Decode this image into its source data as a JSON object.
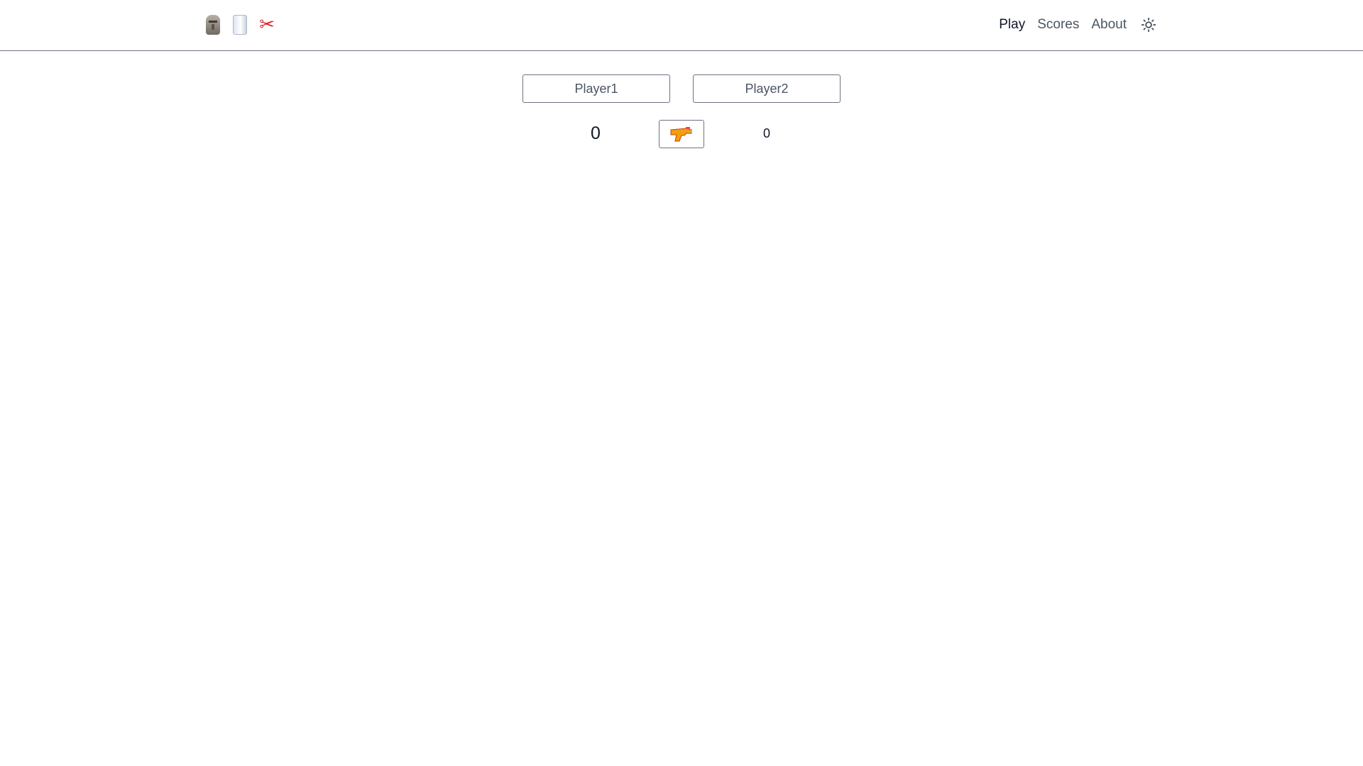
{
  "header": {
    "logo_icons": [
      "moai-icon",
      "paper-icon",
      "scissors-icon"
    ],
    "scissors_glyph": "✂",
    "nav": [
      {
        "label": "Play",
        "active": true
      },
      {
        "label": "Scores",
        "active": false
      },
      {
        "label": "About",
        "active": false
      }
    ],
    "theme_toggle_icon": "sun-icon"
  },
  "game": {
    "player1_label": "Player1",
    "player2_label": "Player2",
    "player1_score": "0",
    "player2_score": "0",
    "action_icon": "water-pistol-icon"
  },
  "colors": {
    "border": "#6b7280",
    "text": "#111827",
    "muted_text": "#4b5563",
    "pistol": "#f59e0b"
  }
}
